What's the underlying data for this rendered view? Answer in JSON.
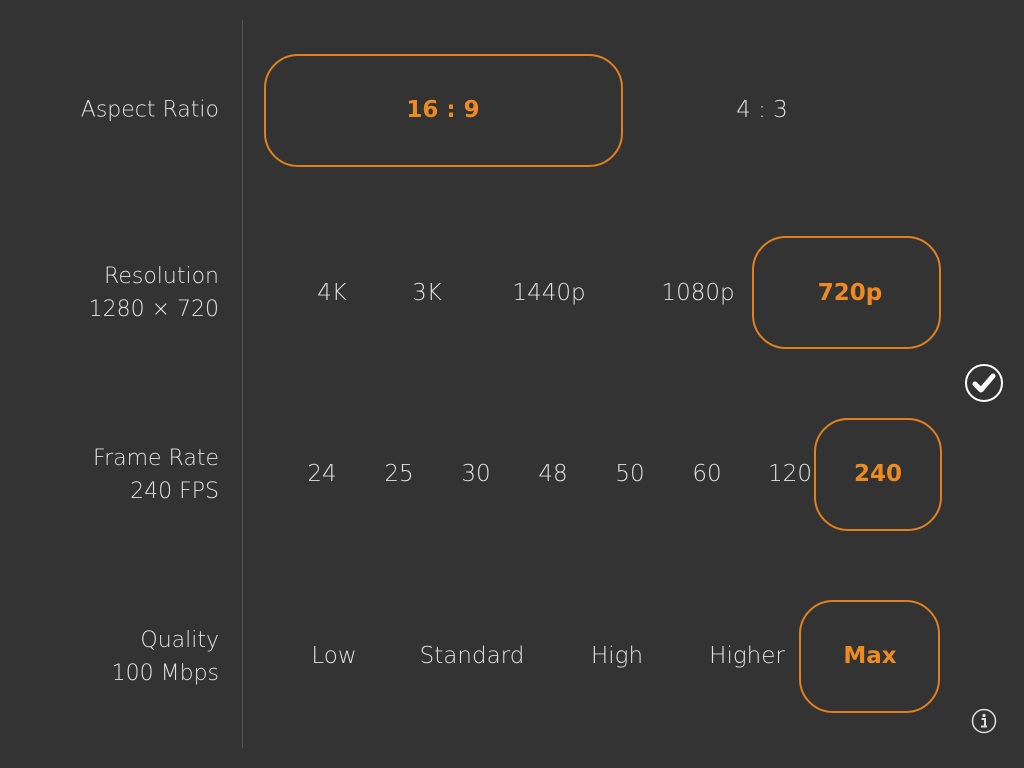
{
  "accent_color": "#ee8a22",
  "aspect": {
    "label": "Aspect Ratio",
    "options": [
      "16 : 9",
      "4 : 3"
    ],
    "selected": "16 : 9"
  },
  "resolution": {
    "label": "Resolution",
    "value": "1280 × 720",
    "options": [
      "4K",
      "3K",
      "1440p",
      "1080p",
      "720p"
    ],
    "selected": "720p"
  },
  "frame_rate": {
    "label": "Frame Rate",
    "value": "240 FPS",
    "options": [
      "24",
      "25",
      "30",
      "48",
      "50",
      "60",
      "120",
      "240"
    ],
    "selected": "240"
  },
  "quality": {
    "label": "Quality",
    "value": "100 Mbps",
    "options": [
      "Low",
      "Standard",
      "High",
      "Higher",
      "Max"
    ],
    "selected": "Max"
  },
  "icons": {
    "confirm": "checkmark-circle-icon",
    "info": "info-icon"
  }
}
